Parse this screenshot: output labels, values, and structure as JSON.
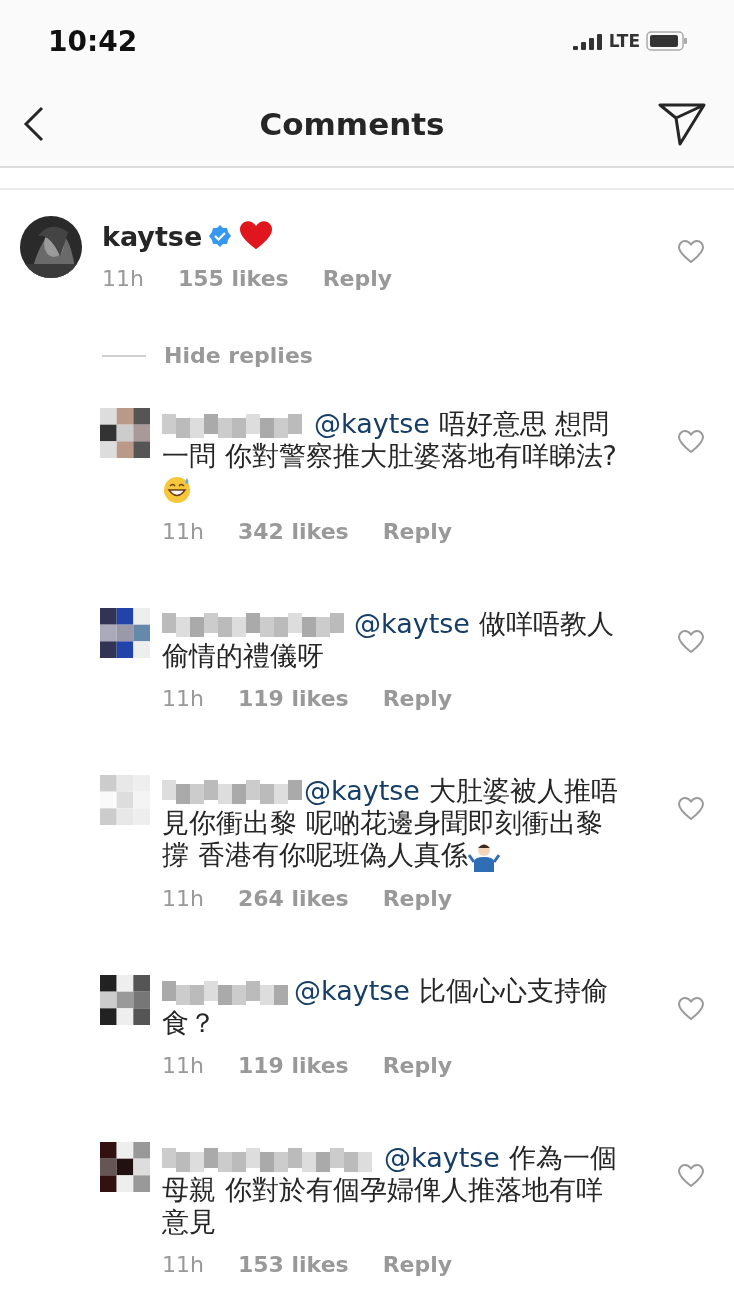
{
  "status_bar": {
    "time": "10:42",
    "network": "LTE"
  },
  "header": {
    "title": "Comments"
  },
  "main_comment": {
    "username": "kaytse",
    "verified": true,
    "time": "11h",
    "likes": "155 likes",
    "reply": "Reply",
    "liked": false
  },
  "hide_replies": "Hide replies",
  "replies": [
    {
      "mention": "@kaytse",
      "text": " 唔好意思 想問一問 你對警察推大肚婆落地有咩睇法?",
      "kind": "sweat",
      "time": "11h",
      "likes": "342 likes",
      "reply": "Reply",
      "liked": false
    },
    {
      "mention": "@kaytse",
      "text": " 做咩唔教人偷情的禮儀呀",
      "kind": "plain",
      "time": "11h",
      "likes": "119 likes",
      "reply": "Reply",
      "liked": false
    },
    {
      "mention": "@kaytse",
      "text": " 大肚婆被人推唔見你衝出黎 呢啲花邊身聞即刻衝出黎撐 香港有你呢班偽人真係",
      "kind": "shrug",
      "time": "11h",
      "likes": "264 likes",
      "reply": "Reply",
      "liked": false
    },
    {
      "mention": "@kaytse",
      "text": " 比個心心支持偷食？",
      "kind": "plain",
      "time": "11h",
      "likes": "119 likes",
      "reply": "Reply",
      "liked": false
    },
    {
      "mention": "@kaytse",
      "text": " 作為一個母親 你對於有個孕婦俾人推落地有咩意見",
      "kind": "plain",
      "time": "11h",
      "likes": "153 likes",
      "reply": "Reply",
      "liked": false
    }
  ]
}
